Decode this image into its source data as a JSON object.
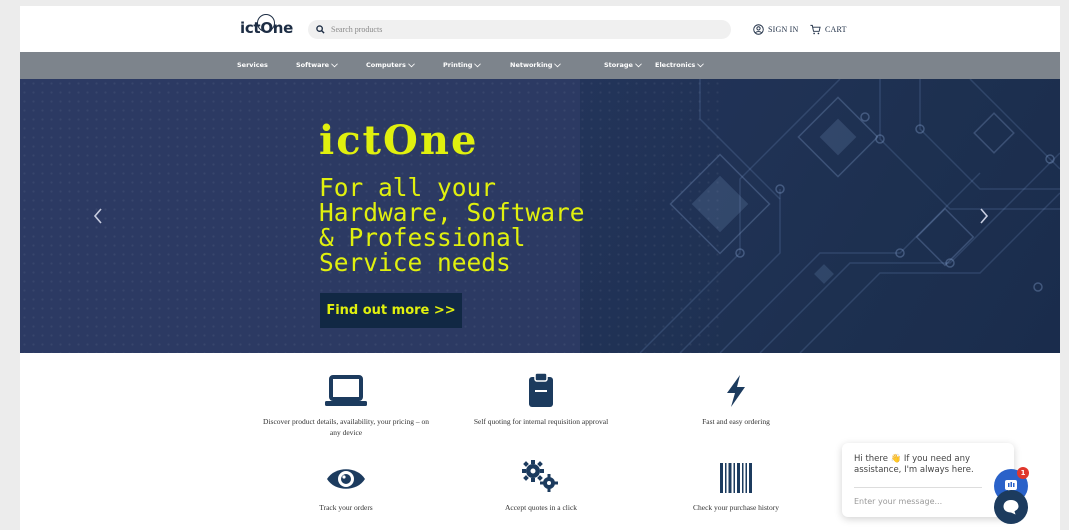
{
  "header": {
    "logo_prefix": "ict",
    "logo_ring": "O",
    "logo_suffix": "ne",
    "search_placeholder": "Search products",
    "sign_in": "SIGN IN",
    "cart": "CART"
  },
  "nav": {
    "items": [
      {
        "label": "Services",
        "dropdown": false
      },
      {
        "label": "Software",
        "dropdown": true
      },
      {
        "label": "Computers",
        "dropdown": true
      },
      {
        "label": "Printing",
        "dropdown": true
      },
      {
        "label": "Networking",
        "dropdown": true
      },
      {
        "label": "Storage",
        "dropdown": true
      },
      {
        "label": "Electronics",
        "dropdown": true
      }
    ]
  },
  "hero": {
    "title": "ictOne",
    "text": "For all your\nHardware, Software\n& Professional\nService needs",
    "cta": "Find out more >>"
  },
  "features": [
    {
      "icon": "laptop-icon",
      "caption": "Discover product details, availability, your pricing – on any device"
    },
    {
      "icon": "clipboard-icon",
      "caption": "Self quoting for internal requisition approval"
    },
    {
      "icon": "lightning-icon",
      "caption": "Fast and easy ordering"
    },
    {
      "icon": "eye-icon",
      "caption": "Track your orders"
    },
    {
      "icon": "gears-icon",
      "caption": "Accept quotes in a click"
    },
    {
      "icon": "barcode-icon",
      "caption": "Check your purchase history"
    }
  ],
  "chat": {
    "message": "Hi there 👋 If you need any assistance, I'm always here.",
    "input_placeholder": "Enter your message...",
    "badge_count": "1"
  },
  "colors": {
    "accent_yellow": "#e0f00e",
    "hero_bg": "#2c3a63",
    "nav_bg": "#7d848c",
    "icon_dark": "#1c3b5e",
    "chat_blue": "#2a62c9"
  }
}
